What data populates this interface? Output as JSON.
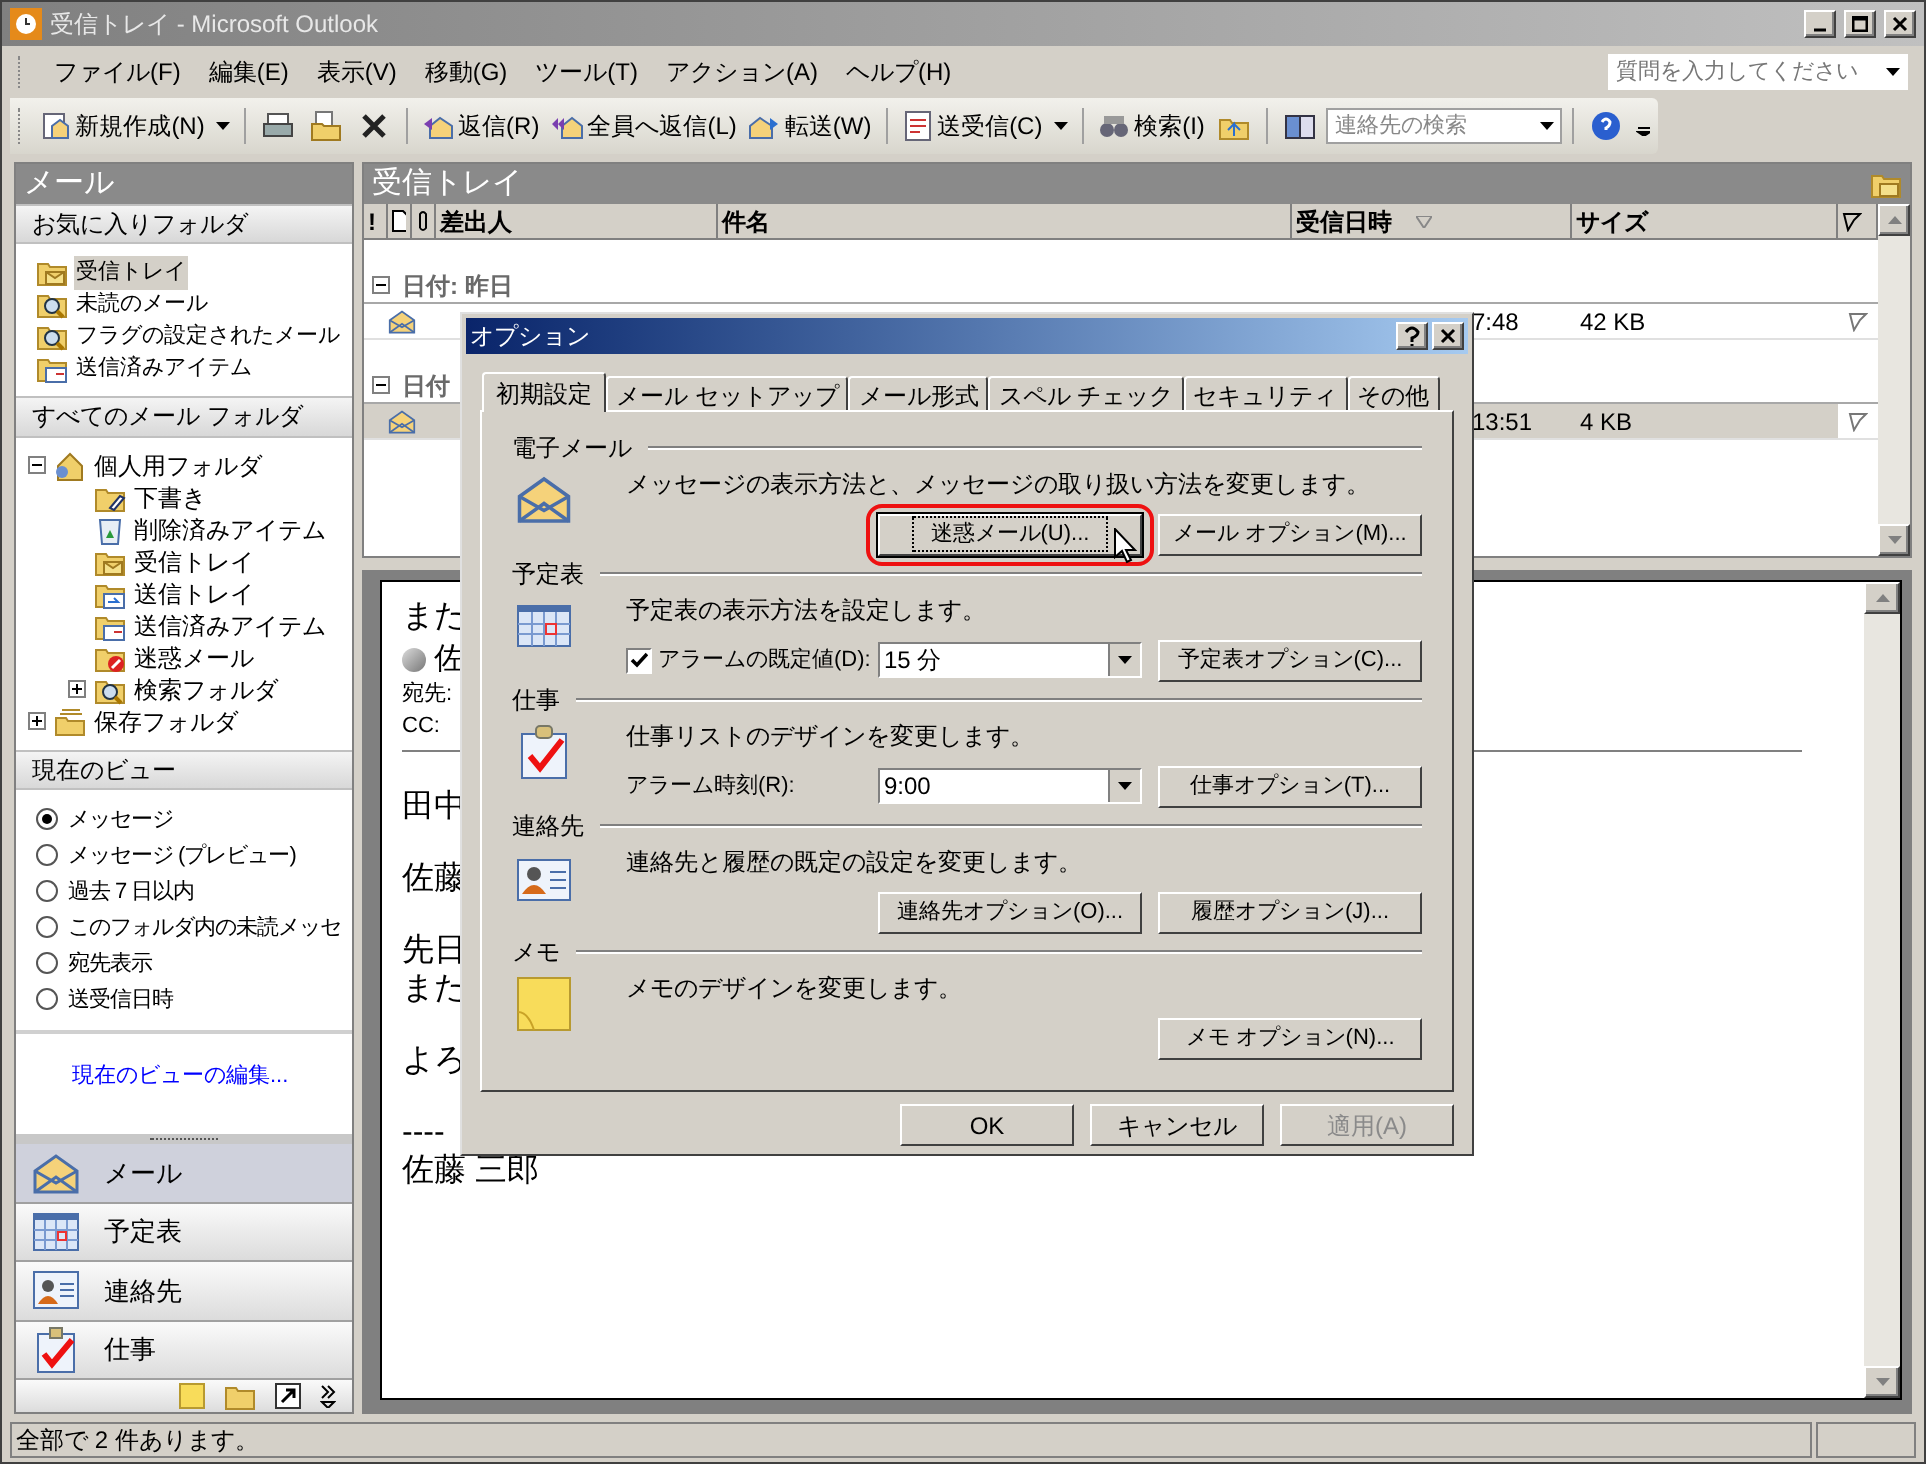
{
  "window": {
    "title": "受信トレイ - Microsoft Outlook"
  },
  "menu": [
    "ファイル(F)",
    "編集(E)",
    "表示(V)",
    "移動(G)",
    "ツール(T)",
    "アクション(A)",
    "ヘルプ(H)"
  ],
  "help_search": {
    "placeholder": "質問を入力してください"
  },
  "toolbar": [
    {
      "kind": "button",
      "label": "新規作成(N)",
      "dropdown": true
    },
    {
      "kind": "separator"
    },
    {
      "kind": "icon"
    },
    {
      "kind": "icon"
    },
    {
      "kind": "icon"
    },
    {
      "kind": "separator"
    },
    {
      "kind": "button",
      "label": "返信(R)",
      "dropdown": false
    },
    {
      "kind": "button",
      "label": "全員へ返信(L)",
      "dropdown": false
    },
    {
      "kind": "button",
      "label": "転送(W)",
      "dropdown": false
    },
    {
      "kind": "separator"
    },
    {
      "kind": "button",
      "label": "送受信(C)",
      "dropdown": true
    },
    {
      "kind": "separator"
    },
    {
      "kind": "button",
      "label": "検索(I)",
      "dropdown": false
    },
    {
      "kind": "icon"
    },
    {
      "kind": "separator"
    },
    {
      "kind": "icon"
    },
    {
      "kind": "search",
      "placeholder": "連絡先の検索"
    },
    {
      "kind": "separator"
    },
    {
      "kind": "icon"
    }
  ],
  "nav_pane": {
    "title": "メール",
    "favorites_header": "お気に入りフォルダ",
    "favorites": [
      {
        "label": "受信トレイ",
        "selected": true
      },
      {
        "label": "未読のメール",
        "selected": false
      },
      {
        "label": "フラグの設定されたメール",
        "selected": false
      },
      {
        "label": "送信済みアイテム",
        "selected": false
      }
    ],
    "all_folders_header": "すべてのメール フォルダ",
    "folders": [
      {
        "label": "個人用フォルダ",
        "expanded": true,
        "children": [
          {
            "label": "下書き"
          },
          {
            "label": "削除済みアイテム"
          },
          {
            "label": "受信トレイ"
          },
          {
            "label": "送信トレイ"
          },
          {
            "label": "送信済みアイテム"
          },
          {
            "label": "迷惑メール"
          },
          {
            "label": "検索フォルダ",
            "expanded": false
          }
        ]
      },
      {
        "label": "保存フォルダ",
        "expanded": false
      }
    ],
    "views_header": "現在のビュー",
    "views": [
      {
        "label": "メッセージ",
        "selected": true
      },
      {
        "label": "メッセージ (プレビュー)",
        "selected": false
      },
      {
        "label": "過去 7 日以内",
        "selected": false
      },
      {
        "label": "このフォルダ内の未読メッセ",
        "selected": false
      },
      {
        "label": "宛先表示",
        "selected": false
      },
      {
        "label": "送受信日時",
        "selected": false
      }
    ],
    "edit_view_link": "現在のビューの編集...",
    "buttons": [
      {
        "label": "メール",
        "selected": true
      },
      {
        "label": "予定表",
        "selected": false
      },
      {
        "label": "連絡先",
        "selected": false
      },
      {
        "label": "仕事",
        "selected": false
      }
    ]
  },
  "folder": {
    "title": "受信トレイ",
    "columns": [
      {
        "kind": "text",
        "label": "!"
      },
      {
        "kind": "icon"
      },
      {
        "kind": "icon"
      },
      {
        "kind": "text",
        "label": "差出人"
      },
      {
        "kind": "text",
        "label": "件名"
      },
      {
        "kind": "text",
        "label": "受信日時",
        "sorted": true
      },
      {
        "kind": "text",
        "label": "サイズ"
      },
      {
        "kind": "icon"
      }
    ],
    "groups": [
      {
        "header": "日付: 昨日",
        "rows": [
          {
            "received": "7:48",
            "size": "42 KB",
            "selected": false
          }
        ]
      },
      {
        "header": "日付",
        "rows": [
          {
            "received": "13:51",
            "size": "4 KB",
            "selected": true
          }
        ]
      }
    ]
  },
  "reading_pane": {
    "subject": "また",
    "from": "佐",
    "to_label": "宛先:",
    "cc_label": "CC:",
    "body": [
      [
        "田中"
      ],
      [
        "佐藤"
      ],
      [
        "先日",
        "また"
      ],
      [
        "よろ"
      ],
      [
        "----",
        "佐藤 三郎"
      ]
    ]
  },
  "dialog": {
    "title": "オプション",
    "tabs": [
      {
        "label": "初期設定",
        "selected": true
      },
      {
        "label": "メール セットアップ",
        "selected": false
      },
      {
        "label": "メール形式",
        "selected": false
      },
      {
        "label": "スペル チェック",
        "selected": false
      },
      {
        "label": "セキュリティ",
        "selected": false
      },
      {
        "label": "その他",
        "selected": false
      }
    ],
    "sections": [
      {
        "title": "電子メール",
        "description": "メッセージの表示方法と、メッセージの取り扱い方法を変更します。",
        "buttons": [
          {
            "label": "迷惑メール(U)...",
            "highlighted": true
          },
          {
            "label": "メール オプション(M)...",
            "highlighted": false
          }
        ]
      },
      {
        "title": "予定表",
        "description": "予定表の表示方法を設定します。",
        "checkbox": {
          "label": "アラームの既定値(D):",
          "checked": true
        },
        "combo": "15 分",
        "buttons": [
          {
            "label": "予定表オプション(C)...",
            "highlighted": false
          }
        ]
      },
      {
        "title": "仕事",
        "description": "仕事リストのデザインを変更します。",
        "field_label": "アラーム時刻(R):",
        "combo": "9:00",
        "buttons": [
          {
            "label": "仕事オプション(T)...",
            "highlighted": false
          }
        ]
      },
      {
        "title": "連絡先",
        "description": "連絡先と履歴の既定の設定を変更します。",
        "buttons": [
          {
            "label": "連絡先オプション(O)...",
            "highlighted": false
          },
          {
            "label": "履歴オプション(J)...",
            "highlighted": false
          }
        ]
      },
      {
        "title": "メモ",
        "description": "メモのデザインを変更します。",
        "buttons": [
          {
            "label": "メモ オプション(N)...",
            "highlighted": false
          }
        ]
      }
    ],
    "footer": [
      {
        "label": "OK",
        "disabled": false
      },
      {
        "label": "キャンセル",
        "disabled": false
      },
      {
        "label": "適用(A)",
        "disabled": true
      }
    ]
  },
  "status_bar": "全部で 2 件あります。"
}
